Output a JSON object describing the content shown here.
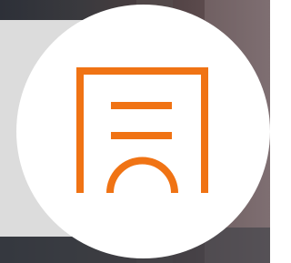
{
  "button": {
    "icon": "document-icon",
    "background_color": "#ffffff",
    "icon_color": "#f07314"
  },
  "side_panel": {
    "color": "#dcdcdc"
  }
}
